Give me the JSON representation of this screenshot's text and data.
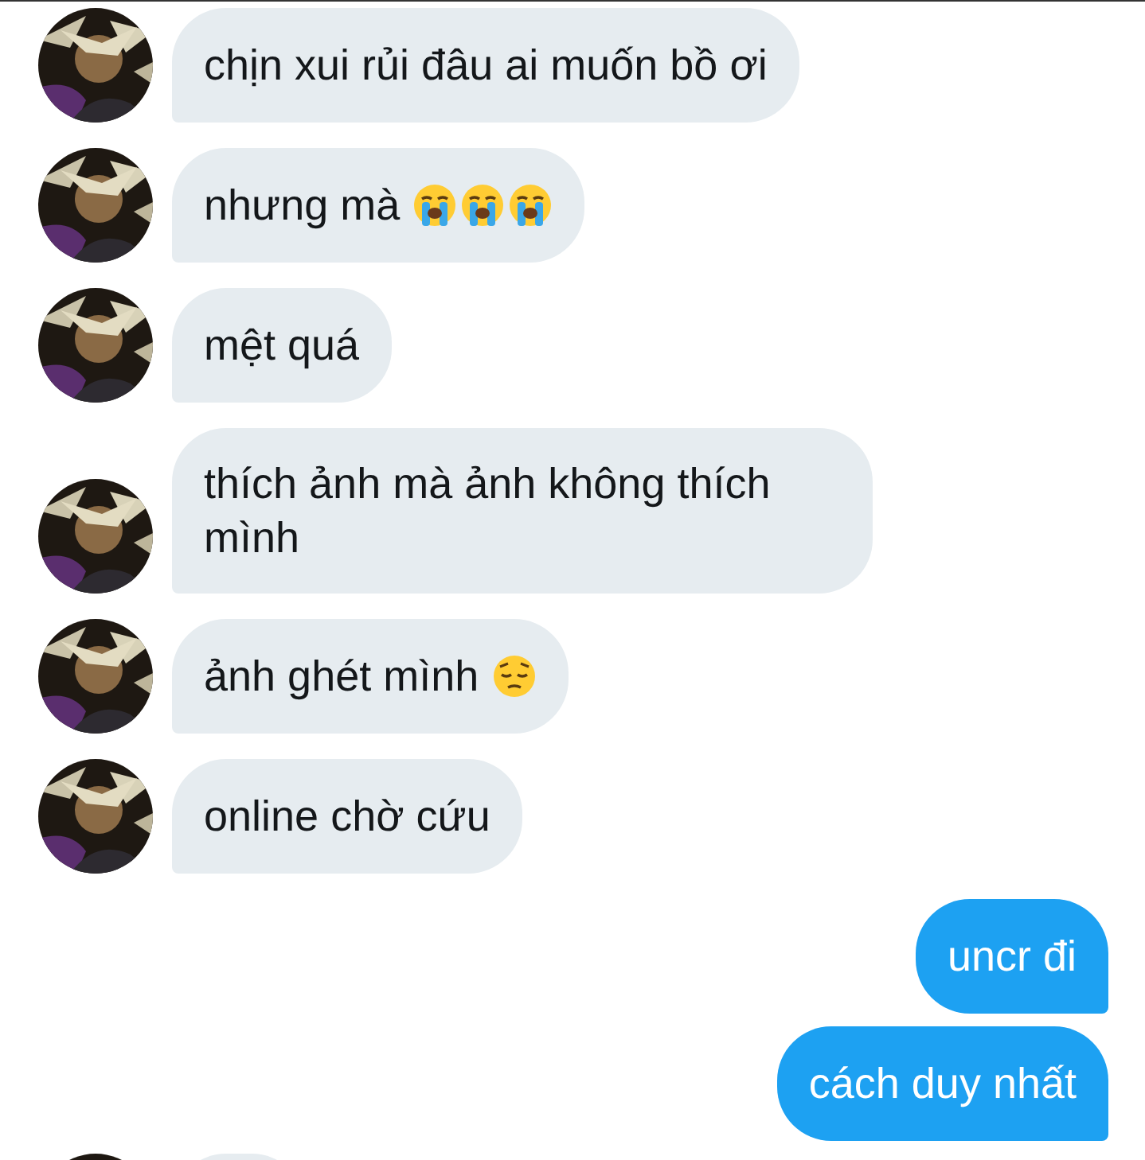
{
  "messages": [
    {
      "kind": "incoming",
      "text": "chịn xui rủi đâu ai muốn bồ ơi"
    },
    {
      "kind": "incoming",
      "text": "nhưng mà",
      "emojis": [
        {
          "kind": "crying"
        },
        {
          "kind": "crying"
        },
        {
          "kind": "crying"
        }
      ]
    },
    {
      "kind": "incoming",
      "text": "mệt quá"
    },
    {
      "kind": "incoming",
      "text": "thích ảnh mà ảnh không thích mình"
    },
    {
      "kind": "incoming",
      "text": "ảnh ghét mình",
      "emojis": [
        {
          "kind": "pensive"
        }
      ]
    },
    {
      "kind": "incoming",
      "text": "online chờ cứu"
    },
    {
      "kind": "outgoing",
      "text": "uncr đi"
    },
    {
      "kind": "outgoing",
      "text": "cách duy nhất"
    },
    {
      "kind": "incoming"
    }
  ]
}
